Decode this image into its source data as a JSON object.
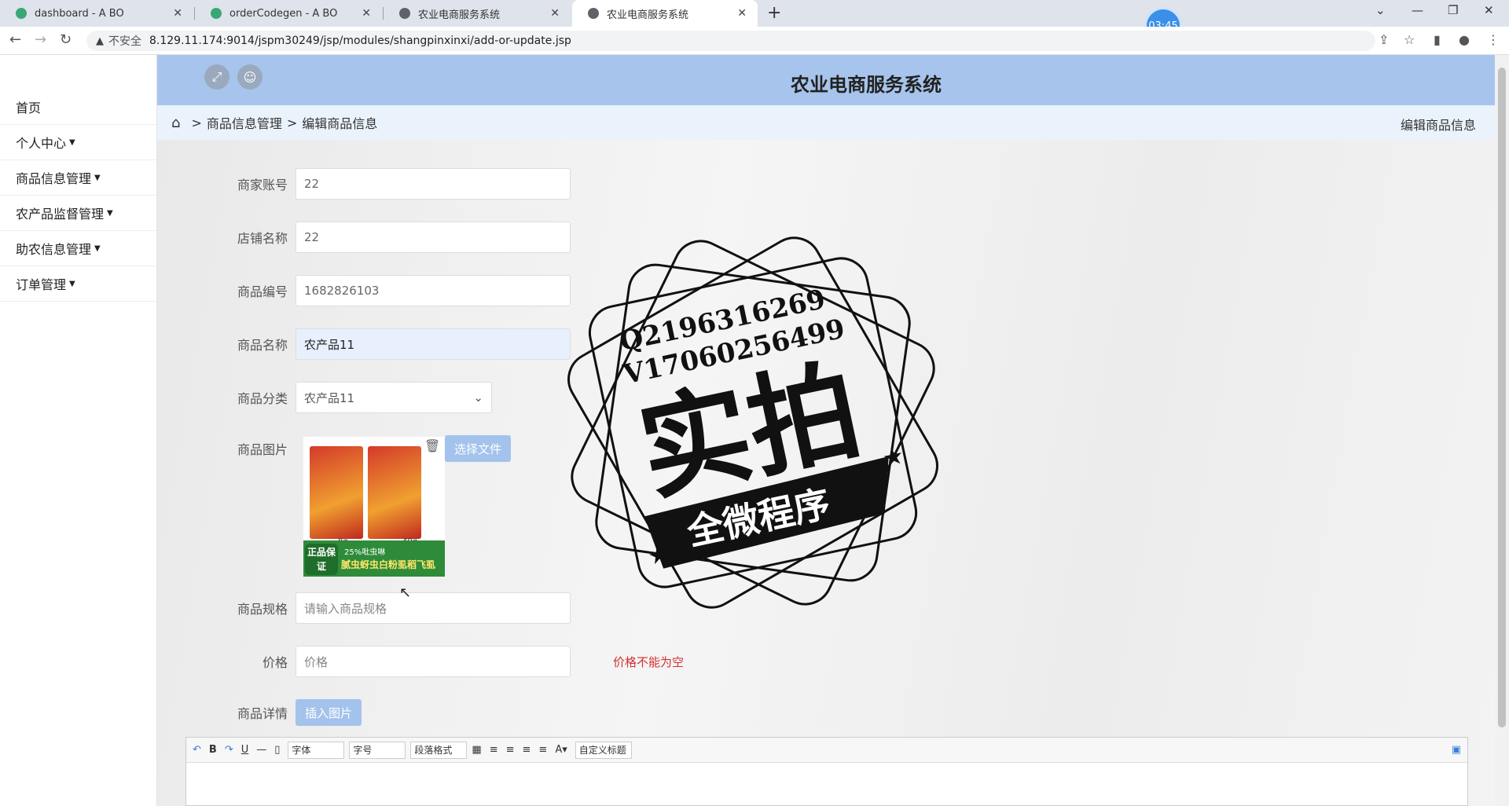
{
  "browser": {
    "tabs": [
      {
        "label": "dashboard - A BO",
        "active": false
      },
      {
        "label": "orderCodegen - A BO",
        "active": false
      },
      {
        "label": "农业电商服务系统",
        "active": false
      },
      {
        "label": "农业电商服务系统",
        "active": true
      }
    ],
    "timer": "03:45",
    "security_label": "不安全",
    "url": "8.129.11.174:9014/jspm30249/jsp/modules/shangpinxinxi/add-or-update.jsp"
  },
  "app": {
    "title": "农业电商服务系统"
  },
  "sidebar": {
    "items": [
      {
        "label": "首页"
      },
      {
        "label": "个人中心"
      },
      {
        "label": "商品信息管理"
      },
      {
        "label": "农产品监督管理"
      },
      {
        "label": "助农信息管理"
      },
      {
        "label": "订单管理"
      }
    ]
  },
  "breadcrumb": {
    "level1": "商品信息管理",
    "level2": "编辑商品信息",
    "right": "编辑商品信息"
  },
  "form": {
    "merchant_account": {
      "label": "商家账号",
      "value": "22"
    },
    "shop_name": {
      "label": "店铺名称",
      "value": "22"
    },
    "product_code": {
      "label": "商品编号",
      "value": "1682826103"
    },
    "product_name": {
      "label": "商品名称",
      "value": "农产品11"
    },
    "category": {
      "label": "商品分类",
      "value": "农产品11"
    },
    "image": {
      "label": "商品图片",
      "choose_button": "选择文件",
      "img_label_8g": "8g",
      "img_label_40g": "40g",
      "img_badge": "正品保证",
      "img_text": "腻虫蚜虫白粉虱稻飞虱",
      "img_percent": "25%吡虫啉"
    },
    "spec": {
      "label": "商品规格",
      "placeholder": "请输入商品规格"
    },
    "price": {
      "label": "价格",
      "placeholder": "价格",
      "error": "价格不能为空"
    },
    "detail": {
      "label": "商品详情",
      "insert_button": "插入图片"
    }
  },
  "editor": {
    "font_select": "字体",
    "size_select": "字号",
    "para_select": "段落格式",
    "custom_select": "自定义标题"
  },
  "watermark": {
    "line1": "Q2196316269",
    "line2": "V17060256499",
    "main": "实拍",
    "banner": "全微程序"
  }
}
